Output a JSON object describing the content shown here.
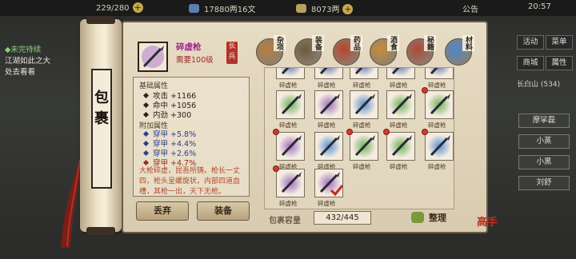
{
  "topbar": {
    "res1": "229/280",
    "res2": "17880两16文",
    "res3": "8073两",
    "announce": "公告",
    "time": "20:57"
  },
  "quest": {
    "title": "◆未完待续",
    "line1": "江湖如此之大",
    "line2": "处去看看"
  },
  "rightmenu": {
    "activity": "活动",
    "menu": "菜单",
    "shop": "商城",
    "attrs": "属性",
    "location": "长白山",
    "coords": "(534)"
  },
  "sidebtns": [
    "摩挲磊",
    "小蒸",
    "小黑",
    "刘舒"
  ],
  "bag_label": "包裹",
  "item": {
    "name": "碎虚枪",
    "requirement": "需要100级",
    "type": "长兵"
  },
  "categories": [
    {
      "label": "杂项",
      "color": "#b87d3e"
    },
    {
      "label": "装备",
      "color": "#6b5a3c"
    },
    {
      "label": "药品",
      "color": "#b9452e"
    },
    {
      "label": "酒食",
      "color": "#c88d3a"
    },
    {
      "label": "秘籍",
      "color": "#b0463a"
    },
    {
      "label": "材料",
      "color": "#4f86c8"
    }
  ],
  "base_stats": {
    "header": "基础属性",
    "items": [
      "攻击 +1166",
      "命中 +1056",
      "内劲 +300"
    ]
  },
  "extra_stats": {
    "header": "附加属性",
    "items": [
      {
        "text": "穿甲 +5.8%",
        "color": "blue"
      },
      {
        "text": "穿甲 +4.4%",
        "color": "blue"
      },
      {
        "text": "穿甲 +2.6%",
        "color": "blue"
      },
      {
        "text": "穿甲 +4.7%",
        "color": "red"
      }
    ]
  },
  "description": "大枪碎虚，昆吾所铸。枪长一丈四，枪头呈螺旋状，内部四道血槽，其枪一出，天下无枪。",
  "slot_name": "碎虚枪",
  "slots": [
    {
      "glow": "#5a6fb0",
      "dot": false,
      "check": false
    },
    {
      "glow": "#5a6fb0",
      "dot": false,
      "check": false
    },
    {
      "glow": "#5a6fb0",
      "dot": false,
      "check": false
    },
    {
      "glow": "#5a6fb0",
      "dot": false,
      "check": false
    },
    {
      "glow": "#5a6fb0",
      "dot": false,
      "check": false
    },
    {
      "glow": "#6fb05a",
      "dot": false,
      "check": false
    },
    {
      "glow": "#a06fc0",
      "dot": false,
      "check": false
    },
    {
      "glow": "#5a8fd0",
      "dot": false,
      "check": false
    },
    {
      "glow": "#6fb05a",
      "dot": false,
      "check": false
    },
    {
      "glow": "#6fb05a",
      "dot": true,
      "check": false
    },
    {
      "glow": "#a06fc0",
      "dot": true,
      "check": false
    },
    {
      "glow": "#5a8fd0",
      "dot": false,
      "check": false
    },
    {
      "glow": "#6fb05a",
      "dot": true,
      "check": false
    },
    {
      "glow": "#6fb05a",
      "dot": true,
      "check": false
    },
    {
      "glow": "#5a8fd0",
      "dot": true,
      "check": false
    },
    {
      "glow": "#a06fc0",
      "dot": true,
      "check": false
    },
    {
      "glow": "#a06fc0",
      "dot": false,
      "check": true
    }
  ],
  "capacity_label": "包裹容量",
  "capacity_value": "432/445",
  "buttons": {
    "discard": "丢弃",
    "equip": "装备",
    "sort": "整理"
  },
  "seal": "高手"
}
